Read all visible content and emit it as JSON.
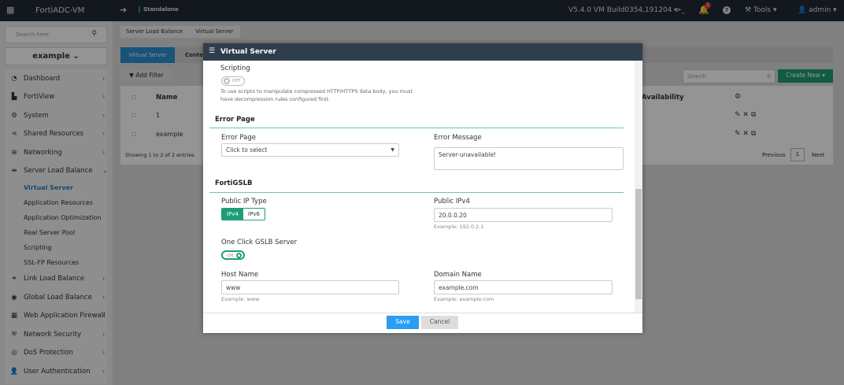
{
  "topbar": {
    "app_name": "FortiADC-VM",
    "mode": "Standalone",
    "version": "V5.4.0 VM Build0354,191204",
    "notifications": "2",
    "tools": "Tools",
    "user": "admin"
  },
  "sidebar": {
    "search_placeholder": "Search here",
    "vdom": "example",
    "items": [
      {
        "label": "Dashboard",
        "icon": "dashboard-icon"
      },
      {
        "label": "FortiView",
        "icon": "chart-icon"
      },
      {
        "label": "System",
        "icon": "gear-icon"
      },
      {
        "label": "Shared Resources",
        "icon": "share-icon"
      },
      {
        "label": "Networking",
        "icon": "globe-icon"
      },
      {
        "label": "Server Load Balance",
        "icon": "balance-icon"
      }
    ],
    "sub_items": [
      "Virtual Server",
      "Application Resources",
      "Application Optimization",
      "Real Server Pool",
      "Scripting",
      "SSL-FP Resources"
    ],
    "items2": [
      {
        "label": "Link Load Balance"
      },
      {
        "label": "Global Load Balance"
      },
      {
        "label": "Web Application Firewall"
      },
      {
        "label": "Network Security"
      },
      {
        "label": "DoS Protection"
      },
      {
        "label": "User Authentication"
      }
    ]
  },
  "main": {
    "breadcrumb": [
      "Server Load Balance",
      "Virtual Server"
    ],
    "tabs": [
      "Virtual Server",
      "Content"
    ],
    "add_filter": "Add Filter",
    "search_placeholder": "Search",
    "create_new": "Create New",
    "columns": [
      "Name",
      "Availability"
    ],
    "rows": [
      {
        "name": "1"
      },
      {
        "name": "example"
      }
    ],
    "showing": "Showing 1 to 2 of 2 entries",
    "prev": "Previous",
    "page": "1",
    "next": "Next"
  },
  "modal": {
    "title": "Virtual Server",
    "scripting_label": "Scripting",
    "scripting_toggle": "OFF",
    "scripting_help1": "To use scripts to manipulate compressed HTTP/HTTPS data body, you must",
    "scripting_help2": "have decompression rules configured first.",
    "error_section": "Error Page",
    "error_page_label": "Error Page",
    "error_page_value": "Click to select",
    "error_message_label": "Error Message",
    "error_message_value": "Server-unavailable!",
    "gslb_section": "FortiGSLB",
    "ip_type_label": "Public IP Type",
    "ip_type_options": [
      "IPv4",
      "IPv6"
    ],
    "ipv4_label": "Public IPv4",
    "ipv4_value": "20.0.0.20",
    "ipv4_hint": "Example: 192.0.2.1",
    "one_click_label": "One Click GSLB Server",
    "one_click_toggle": "ON",
    "host_label": "Host Name",
    "host_value": "www",
    "host_hint": "Example: www",
    "domain_label": "Domain Name",
    "domain_value": "example.com",
    "domain_hint": "Example: example.com",
    "save": "Save",
    "cancel": "Cancel"
  },
  "colors": {
    "accent_green": "#1e9e78",
    "save_blue": "#2a9df4",
    "header": "#2f3e4c"
  }
}
